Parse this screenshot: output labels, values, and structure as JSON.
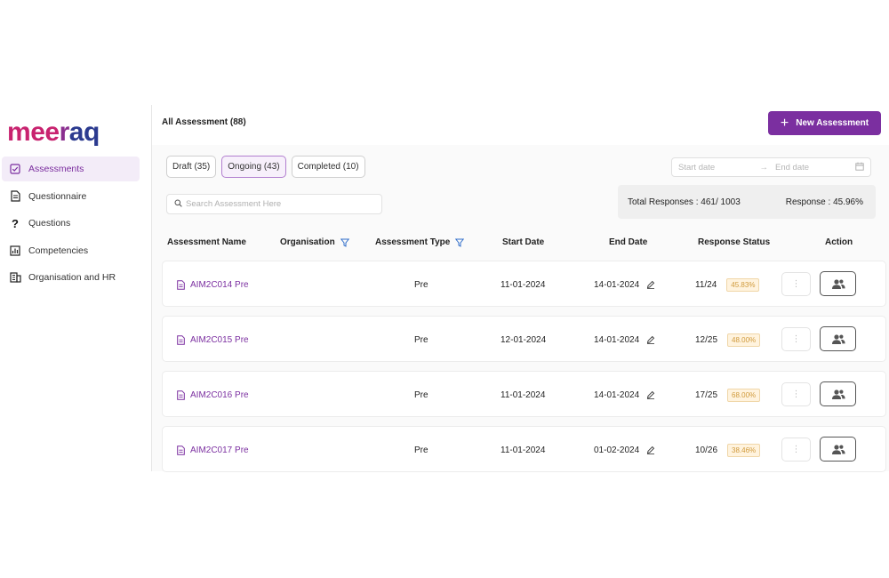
{
  "brand": {
    "logo_text": "meeraq"
  },
  "sidebar": {
    "items": [
      {
        "label": "Assessments",
        "icon": "clipboard-check-icon",
        "active": true
      },
      {
        "label": "Questionnaire",
        "icon": "document-icon",
        "active": false
      },
      {
        "label": "Questions",
        "icon": "question-mark-icon",
        "active": false
      },
      {
        "label": "Competencies",
        "icon": "bar-chart-icon",
        "active": false
      },
      {
        "label": "Organisation and HR",
        "icon": "building-icon",
        "active": false
      }
    ]
  },
  "header": {
    "title": "All Assessment (88)",
    "new_button": "New Assessment"
  },
  "tabs": [
    {
      "label": "Draft (35)",
      "active": false
    },
    {
      "label": "Ongoing (43)",
      "active": true
    },
    {
      "label": "Completed (10)",
      "active": false
    }
  ],
  "date_filter": {
    "start_placeholder": "Start date",
    "end_placeholder": "End date"
  },
  "search": {
    "placeholder": "Search Assessment Here"
  },
  "summary": {
    "total_responses": "Total Responses : 461/ 1003",
    "response_rate": "Response :  45.96%"
  },
  "table": {
    "columns": [
      "Assessment Name",
      "Organisation",
      "Assessment Type",
      "Start Date",
      "End Date",
      "Response Status",
      "Action"
    ],
    "rows": [
      {
        "name": "AIM2C014 Pre",
        "organisation": "",
        "type": "Pre",
        "start": "11-01-2024",
        "end": "14-01-2024",
        "responses": "11/24",
        "percent": "45.83%"
      },
      {
        "name": "AIM2C015 Pre",
        "organisation": "",
        "type": "Pre",
        "start": "12-01-2024",
        "end": "14-01-2024",
        "responses": "12/25",
        "percent": "48.00%"
      },
      {
        "name": "AIM2C016 Pre",
        "organisation": "",
        "type": "Pre",
        "start": "11-01-2024",
        "end": "14-01-2024",
        "responses": "17/25",
        "percent": "68.00%"
      },
      {
        "name": "AIM2C017 Pre",
        "organisation": "",
        "type": "Pre",
        "start": "11-01-2024",
        "end": "01-02-2024",
        "responses": "10/26",
        "percent": "38.46%"
      }
    ]
  },
  "colors": {
    "brand_purple": "#7b2fa0",
    "logo_magenta": "#c8236f",
    "logo_blue": "#2b3a8f",
    "badge_orange": "#d09a3c"
  }
}
